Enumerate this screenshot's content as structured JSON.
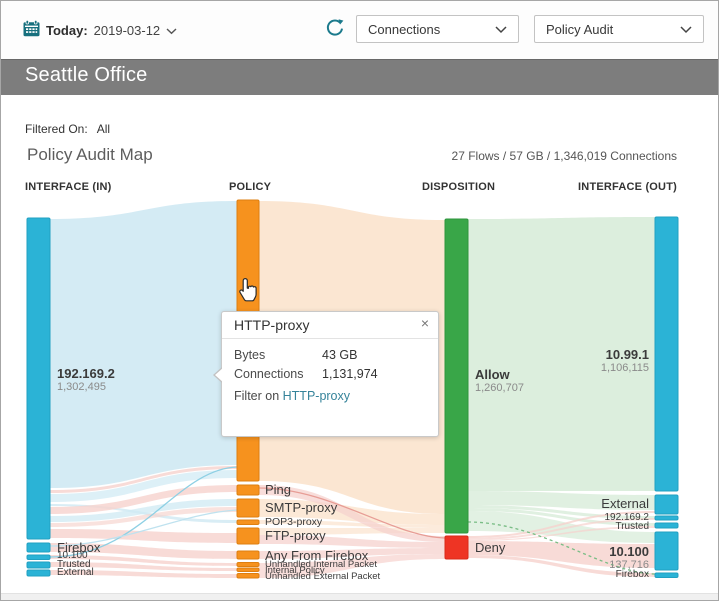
{
  "colors": {
    "teal": "#2bb3d6",
    "orange": "#f6921e",
    "green": "#39a648",
    "red": "#ee3424",
    "flow_blue": "#cfe9f3",
    "flow_peach": "#fbe3cd",
    "flow_pink": "#f6d2cd",
    "flow_green": "#d6ebd7",
    "accent_teal": "#1b7a8c",
    "link": "#35839a",
    "header_gray": "#7d7d7d"
  },
  "toolbar": {
    "date_label": "Today:",
    "date_value": "2019-03-12",
    "report_type": "Connections",
    "report_name": "Policy Audit"
  },
  "header": {
    "title": "Seattle Office"
  },
  "filter": {
    "label": "Filtered On:",
    "value": "All"
  },
  "map": {
    "title": "Policy Audit Map",
    "summary": "27 Flows / 57 GB / 1,346,019 Connections"
  },
  "columns": [
    "INTERFACE (IN)",
    "POLICY",
    "DISPOSITION",
    "INTERFACE (OUT)"
  ],
  "tooltip": {
    "title": "HTTP-proxy",
    "close_icon": "×",
    "rows": [
      {
        "label": "Bytes",
        "value": "43 GB"
      },
      {
        "label": "Connections",
        "value": "1,131,974"
      }
    ],
    "link_prefix": "Filter on ",
    "link_text": "HTTP-proxy"
  },
  "chart_data": {
    "type": "sankey",
    "title": "Policy Audit Map",
    "totals": {
      "flows": "27",
      "bytes": "57 GB",
      "connections": "1,346,019"
    },
    "columns": [
      "INTERFACE (IN)",
      "POLICY",
      "DISPOSITION",
      "INTERFACE (OUT)"
    ],
    "nodes": [
      {
        "id": "in-192169-2",
        "column": "INTERFACE (IN)",
        "label": "192.169.2",
        "connections": "1,302,495"
      },
      {
        "id": "in-firebox",
        "column": "INTERFACE (IN)",
        "label": "Firebox"
      },
      {
        "id": "in-10-100",
        "column": "INTERFACE (IN)",
        "label": "10.100"
      },
      {
        "id": "in-trusted",
        "column": "INTERFACE (IN)",
        "label": "Trusted"
      },
      {
        "id": "in-external",
        "column": "INTERFACE (IN)",
        "label": "External"
      },
      {
        "id": "po-http",
        "column": "POLICY",
        "label": "HTTP-proxy",
        "bytes": "43 GB",
        "connections": "1,131,974"
      },
      {
        "id": "po-ping",
        "column": "POLICY",
        "label": "Ping"
      },
      {
        "id": "po-smtp",
        "column": "POLICY",
        "label": "SMTP-proxy"
      },
      {
        "id": "po-pop3",
        "column": "POLICY",
        "label": "POP3-proxy"
      },
      {
        "id": "po-ftp",
        "column": "POLICY",
        "label": "FTP-proxy"
      },
      {
        "id": "po-anyff",
        "column": "POLICY",
        "label": "Any From Firebox"
      },
      {
        "id": "po-uip",
        "column": "POLICY",
        "label": "Unhandled Internal Packet"
      },
      {
        "id": "po-ip",
        "column": "POLICY",
        "label": "Internal Policy"
      },
      {
        "id": "po-uep",
        "column": "POLICY",
        "label": "Unhandled External Packet"
      },
      {
        "id": "di-allow",
        "column": "DISPOSITION",
        "label": "Allow",
        "connections": "1,260,707"
      },
      {
        "id": "di-deny",
        "column": "DISPOSITION",
        "label": "Deny"
      },
      {
        "id": "out-10-99-1",
        "column": "INTERFACE (OUT)",
        "label": "10.99.1",
        "connections": "1,106,115"
      },
      {
        "id": "out-external",
        "column": "INTERFACE (OUT)",
        "label": "External"
      },
      {
        "id": "out-192169-2",
        "column": "INTERFACE (OUT)",
        "label": "192.169.2"
      },
      {
        "id": "out-trusted",
        "column": "INTERFACE (OUT)",
        "label": "Trusted"
      },
      {
        "id": "out-10-100",
        "column": "INTERFACE (OUT)",
        "label": "10.100",
        "connections": "137,716"
      },
      {
        "id": "out-firebox",
        "column": "INTERFACE (OUT)",
        "label": "Firebox"
      }
    ],
    "highlighted_link": {
      "policy": "HTTP-proxy",
      "bytes": "43 GB",
      "connections": "1,131,974"
    }
  }
}
